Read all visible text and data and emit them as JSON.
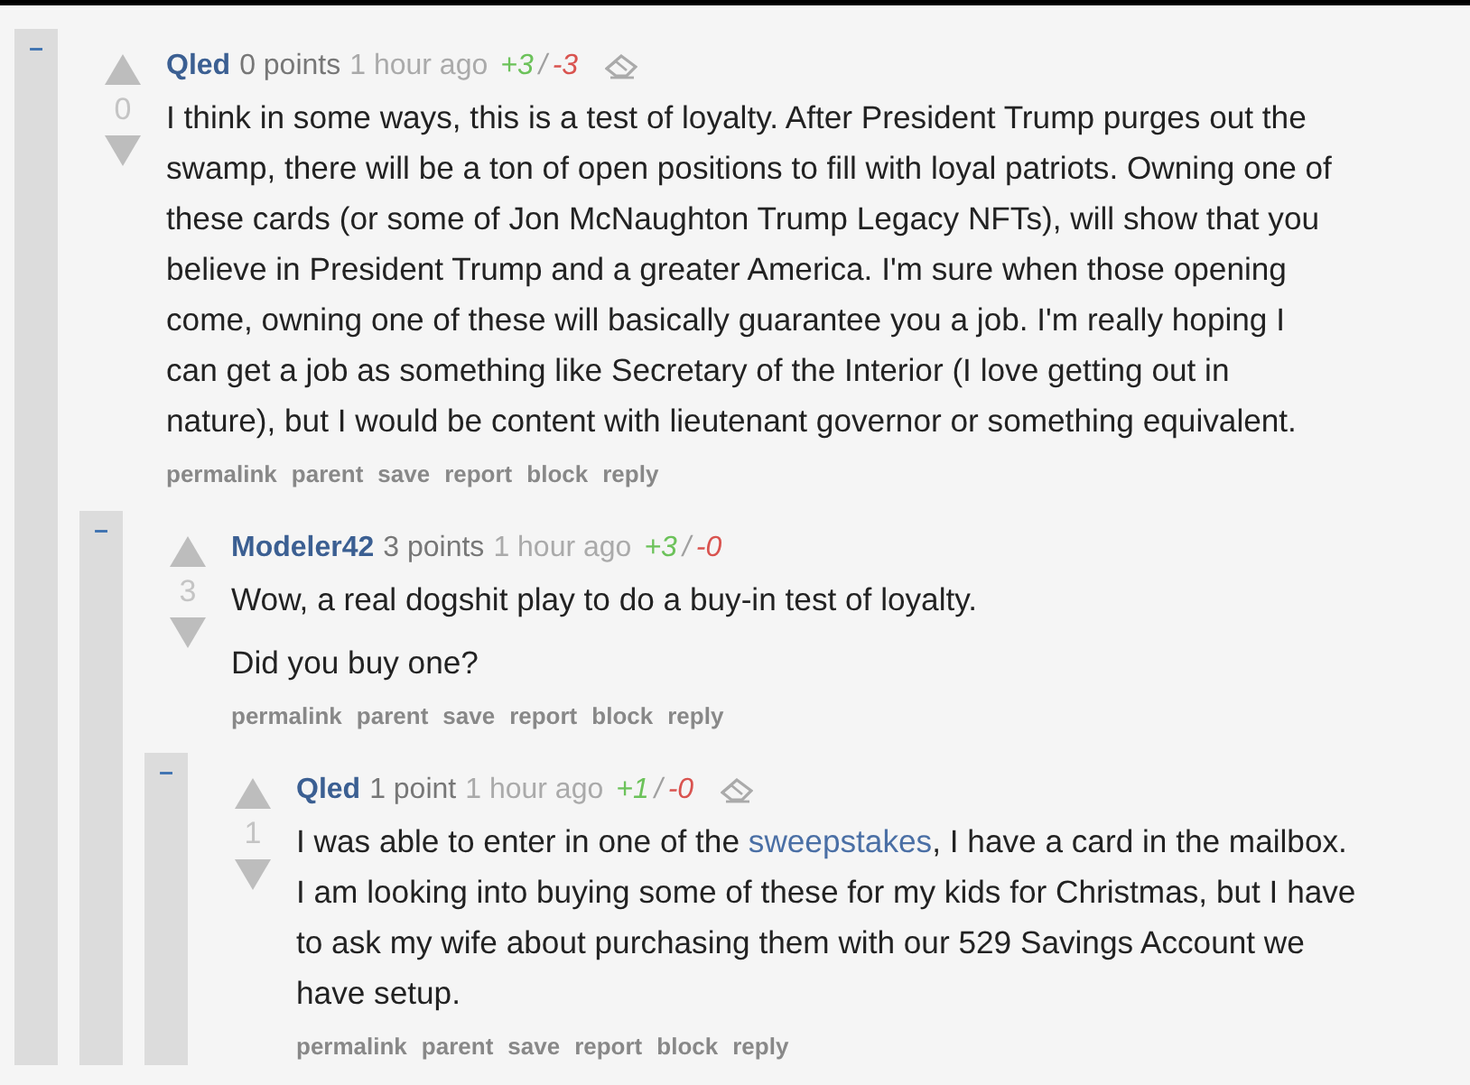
{
  "comments": [
    {
      "author": "Qled",
      "points": "0 points",
      "time": "1 hour ago",
      "ups": "+3",
      "sep": "/",
      "downs": "-3",
      "show_clear_icon": true,
      "collapse": "–",
      "score": "0",
      "paragraphs": [
        {
          "lines": [
            "I think in some ways, this is a test of loyalty. After President Trump purges out the",
            "swamp, there will be a ton of open positions to fill with loyal patriots. Owning one of",
            "these cards (or some of Jon McNaughton Trump Legacy NFTs), will show that you",
            "believe in President Trump and a greater America. I'm sure when those opening",
            "come, owning one of these will basically guarantee you a job. I'm really hoping I",
            "can get a job as something like Secretary of the Interior (I love getting out in",
            "nature), but I would be content with lieutenant governor or something equivalent."
          ]
        }
      ],
      "actions": [
        "permalink",
        "parent",
        "save",
        "report",
        "block",
        "reply"
      ],
      "children": [
        {
          "author": "Modeler42",
          "points": "3 points",
          "time": "1 hour ago",
          "ups": "+3",
          "sep": "/",
          "downs": "-0",
          "show_clear_icon": false,
          "collapse": "–",
          "score": "3",
          "paragraphs": [
            {
              "lines": [
                "Wow, a real dogshit play to do a buy-in test of loyalty."
              ]
            },
            {
              "lines": [
                "Did you buy one?"
              ]
            }
          ],
          "actions": [
            "permalink",
            "parent",
            "save",
            "report",
            "block",
            "reply"
          ],
          "children": [
            {
              "author": "Qled",
              "points": "1 point",
              "time": "1 hour ago",
              "ups": "+1",
              "sep": "/",
              "downs": "-0",
              "show_clear_icon": true,
              "collapse": "–",
              "score": "1",
              "paragraphs": [
                {
                  "lines": [
                    [
                      {
                        "kind": "text",
                        "text": "I was able to enter in one of the "
                      },
                      {
                        "kind": "link",
                        "text": "sweepstakes"
                      },
                      {
                        "kind": "text",
                        "text": ", I have a card in the mailbox."
                      }
                    ],
                    "I am looking into buying some of these for my kids for Christmas, but I have",
                    "to ask my wife about purchasing them with our 529 Savings Account we",
                    "have setup."
                  ]
                }
              ],
              "actions": [
                "permalink",
                "parent",
                "save",
                "report",
                "block",
                "reply"
              ]
            }
          ]
        }
      ]
    }
  ]
}
